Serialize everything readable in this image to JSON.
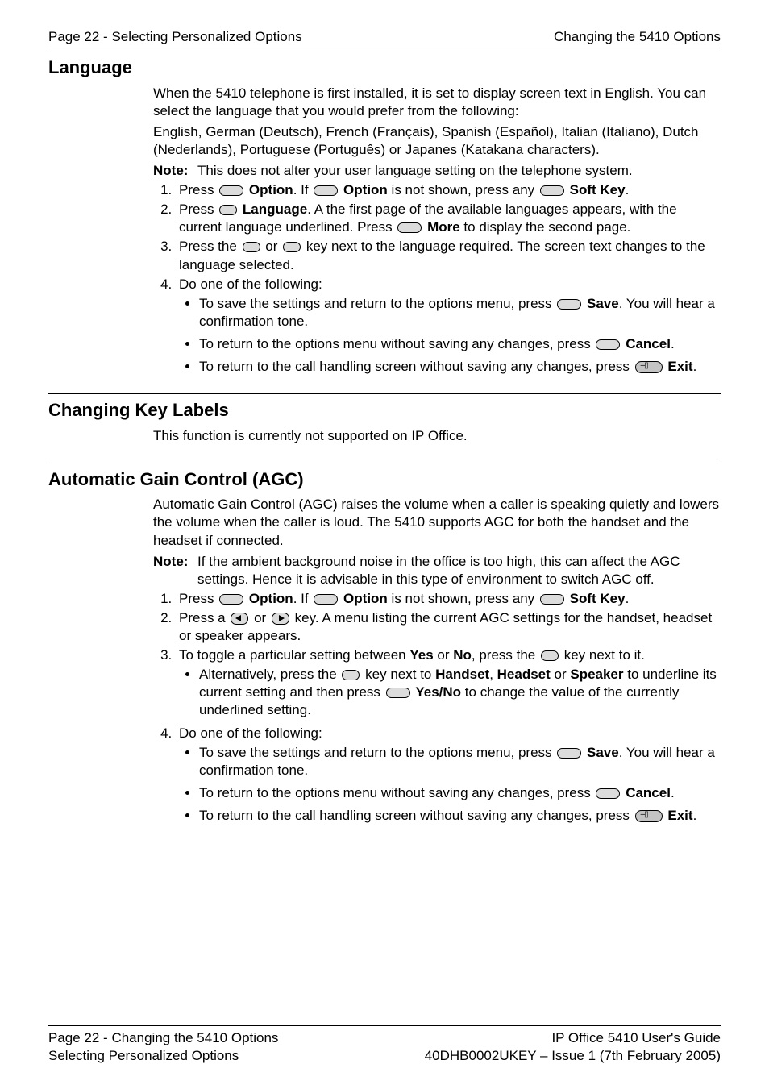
{
  "header": {
    "left": "Page 22 - Selecting Personalized Options",
    "right": "Changing the 5410 Options"
  },
  "language": {
    "title": "Language",
    "intro1": "When the 5410 telephone is first installed, it is set to display screen text in English. You can select the language that you would prefer from the following:",
    "intro2": "English, German (Deutsch), French (Français), Spanish (Español), Italian (Italiano), Dutch (Nederlands), Portuguese (Português) or Japanes (Katakana characters).",
    "noteLabel": "Note:",
    "noteText": "This does not alter your user language setting on the telephone system.",
    "s1a": "Press ",
    "s1b": "Option",
    "s1c": ". If ",
    "s1d": "Option",
    "s1e": " is not shown, press any ",
    "s1f": "Soft Key",
    "s1g": ".",
    "s2a": "Press ",
    "s2b": "Language",
    "s2c": ". A the first page of the available languages appears, with the current language underlined. Press ",
    "s2d": "More",
    "s2e": " to display the second page.",
    "s3a": "Press the ",
    "s3b": " or ",
    "s3c": " key next to the language required. The screen text changes to the language selected.",
    "s4": "Do one of the following:",
    "savea": "To save the settings and return to the options menu, press ",
    "saveb": "Save",
    "savec": ". You will hear a confirmation tone.",
    "cancela": "To return to the options menu without saving any changes, press ",
    "cancelb": "Cancel",
    "cancelc": ".",
    "exita": "To return to the call handling screen without saving any changes, press ",
    "exitb": "Exit",
    "exitc": "."
  },
  "keylabels": {
    "title": "Changing Key Labels",
    "intro": "This function is currently not supported on IP Office."
  },
  "agc": {
    "title": "Automatic Gain Control (AGC)",
    "intro": "Automatic Gain Control (AGC) raises the volume when a caller is speaking quietly and lowers the volume when the caller is loud. The 5410 supports AGC for both the handset and the headset if connected.",
    "noteLabel": "Note:",
    "noteText": "If the ambient background noise in the office is too high, this can affect the AGC settings. Hence it is advisable in this type of environment to switch AGC off.",
    "s1a": "Press ",
    "s1b": "Option",
    "s1c": ". If ",
    "s1d": "Option",
    "s1e": " is not shown, press any ",
    "s1f": "Soft Key",
    "s1g": ".",
    "s2a": "Press a ",
    "s2b": " or ",
    "s2c": " key. A menu listing the current AGC settings for the handset, headset or speaker appears.",
    "s3a": "To toggle a particular setting between ",
    "s3b": "Yes",
    "s3c": " or ",
    "s3d": "No",
    "s3e": ", press the ",
    "s3f": " key next to it.",
    "alt_a": "Alternatively, press the ",
    "alt_b": " key next to ",
    "alt_c": "Handset",
    "alt_d": ", ",
    "alt_e": "Headset",
    "alt_f": " or ",
    "alt_g": "Speaker",
    "alt_h": " to underline its current setting and then press ",
    "alt_i": "Yes/No",
    "alt_j": " to change the value of the currently underlined setting.",
    "s4": "Do one of the following:"
  },
  "footer": {
    "l1l": "Page 22 - Changing the 5410 Options",
    "l1r": "IP Office 5410 User's Guide",
    "l2l": "Selecting Personalized Options",
    "l2r": "40DHB0002UKEY – Issue 1 (7th February 2005)"
  }
}
